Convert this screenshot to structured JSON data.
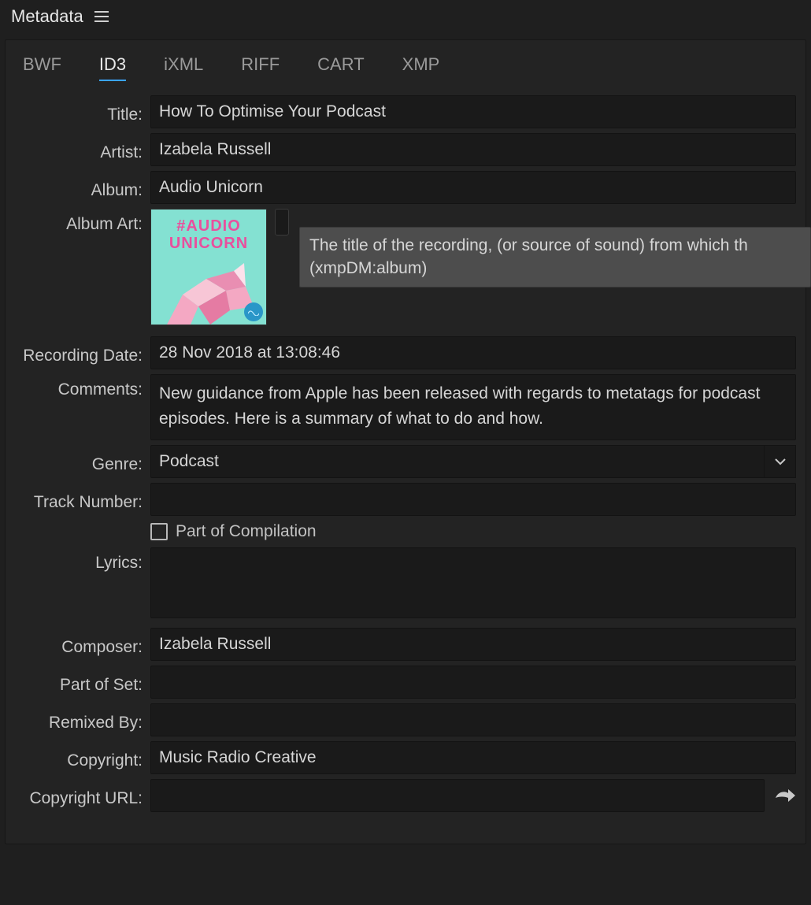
{
  "panel": {
    "title": "Metadata"
  },
  "tabs": {
    "items": [
      {
        "label": "BWF"
      },
      {
        "label": "ID3"
      },
      {
        "label": "iXML"
      },
      {
        "label": "RIFF"
      },
      {
        "label": "CART"
      },
      {
        "label": "XMP"
      }
    ],
    "active_index": 1
  },
  "labels": {
    "title": "Title:",
    "artist": "Artist:",
    "album": "Album:",
    "album_art": "Album Art:",
    "recording_date": "Recording Date:",
    "comments": "Comments:",
    "genre": "Genre:",
    "track_number": "Track Number:",
    "part_of_compilation": "Part of Compilation",
    "lyrics": "Lyrics:",
    "composer": "Composer:",
    "part_of_set": "Part of Set:",
    "remixed_by": "Remixed By:",
    "copyright": "Copyright:",
    "copyright_url": "Copyright URL:"
  },
  "values": {
    "title": "How To Optimise Your Podcast",
    "artist": "Izabela Russell",
    "album": "Audio Unicorn",
    "recording_date": "28 Nov 2018 at 13:08:46",
    "comments": "New guidance from Apple has been released with regards to metatags for podcast episodes. Here is a summary of what to do and how.",
    "genre": "Podcast",
    "track_number": "",
    "part_of_compilation": false,
    "lyrics": "",
    "composer": "Izabela Russell",
    "part_of_set": "",
    "remixed_by": "",
    "copyright": "Music Radio Creative",
    "copyright_url": ""
  },
  "album_art": {
    "text_line1": "#AUDIO",
    "text_line2": "UNICORN"
  },
  "tooltip": {
    "line1": "The title of the recording, (or source of sound) from which th",
    "line2": "(xmpDM:album)"
  }
}
